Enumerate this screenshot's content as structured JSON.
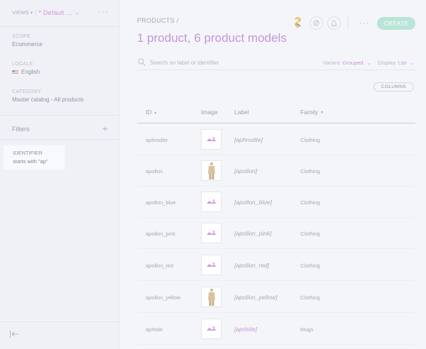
{
  "sidebar": {
    "views_label": "VIEWS",
    "views_value": "* Default ...",
    "scope": {
      "label": "SCOPE",
      "value": "Ecommerce"
    },
    "locale": {
      "label": "LOCALE",
      "value": "English"
    },
    "category": {
      "label": "CATEGORY",
      "value": "Master catalog - All products"
    },
    "filters_title": "Filters",
    "filter": {
      "label": "IDENTIFIER",
      "value": "starts with \"ap\""
    }
  },
  "header": {
    "breadcrumb": "PRODUCTS /",
    "title": "1 product, 6 product models",
    "create_label": "CREATE"
  },
  "search": {
    "placeholder": "Search on label or identifier"
  },
  "toolbar": {
    "variant_label": "Variant:",
    "variant_value": "Grouped",
    "display_label": "Display:",
    "display_value": "List",
    "columns_label": "COLUMNS"
  },
  "table": {
    "columns": [
      "ID",
      "Image",
      "Label",
      "Family"
    ],
    "rows": [
      {
        "id": "aphrodite",
        "label": "[aphrodite]",
        "family": "Clothing",
        "image": "placeholder"
      },
      {
        "id": "apollon",
        "label": "[apollon]",
        "family": "Clothing",
        "image": "person"
      },
      {
        "id": "apollon_blue",
        "label": "[apollon_blue]",
        "family": "Clothing",
        "image": "placeholder"
      },
      {
        "id": "apollon_pink",
        "label": "[apollon_pink]",
        "family": "Clothing",
        "image": "placeholder"
      },
      {
        "id": "apollon_red",
        "label": "[apollon_red]",
        "family": "Clothing",
        "image": "placeholder"
      },
      {
        "id": "apollon_yellow",
        "label": "[apollon_yellow]",
        "family": "Clothing",
        "image": "person"
      },
      {
        "id": "aprlstie",
        "label": "[aprlstie]",
        "family": "Mugs",
        "image": "placeholder"
      }
    ]
  },
  "colors": {
    "accent_purple": "#c596d8",
    "create_green": "#b9e4d6",
    "background": "#f4f5f9",
    "sidebar_background": "#f0f1f6"
  }
}
